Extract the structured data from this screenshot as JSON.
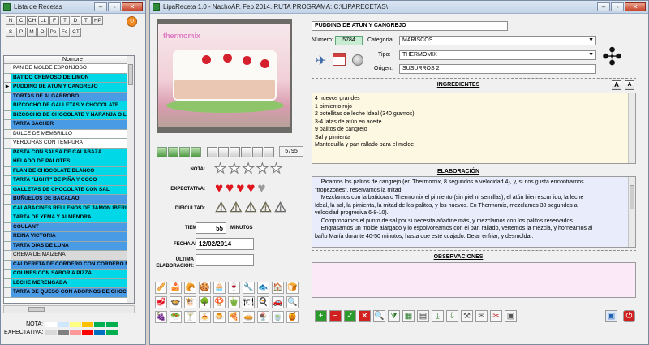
{
  "left_window": {
    "title": "Lista de Recetas",
    "letter_buttons": [
      "N",
      "C",
      "CH",
      "LL",
      "F",
      "T",
      "D",
      "Ti",
      "HP",
      "S",
      "P",
      "M",
      "O",
      "Pe",
      "Fc",
      "CT"
    ],
    "orange_button": "↻",
    "column_header": "Nombre",
    "rows": [
      {
        "name": "PAN DE MOLDE ESPONJOSO",
        "color": "w"
      },
      {
        "name": "BATIDO CREMOSO DE LIMON",
        "color": "c"
      },
      {
        "name": "PUDDING DE ATUN Y CANGREJO",
        "color": "c",
        "current": true
      },
      {
        "name": "TORTAS DE ALGARROBO",
        "color": "b"
      },
      {
        "name": "BIZCOCHO DE GALLETAS Y CHOCOLATE",
        "color": "c"
      },
      {
        "name": "BIZCOCHO DE CHOCOLATE Y NARANJA O LIMON",
        "color": "c"
      },
      {
        "name": "TARTA SACHER",
        "color": "b"
      },
      {
        "name": "DULCE DE MEMBRILLO",
        "color": "w"
      },
      {
        "name": "VERDURAS CON TEMPURA",
        "color": "w"
      },
      {
        "name": "PASTA CON SALSA DE CALABAZA",
        "color": "c"
      },
      {
        "name": "HELADO DE PALOTES",
        "color": "c"
      },
      {
        "name": "FLAN DE CHOCOLATE BLANCO",
        "color": "c"
      },
      {
        "name": "TARTA \"LIGHT\" DE PIÑA Y COCO",
        "color": "c"
      },
      {
        "name": "GALLETAS DE CHOCOLATE CON SAL",
        "color": "c"
      },
      {
        "name": "BUÑUELOS DE BACALAO",
        "color": "b"
      },
      {
        "name": "CALABACINES RELLENOS DE JAMON IBERICO Y",
        "color": "c"
      },
      {
        "name": "TARTA DE YEMA Y ALMENDRA",
        "color": "c"
      },
      {
        "name": "COULANT",
        "color": "b"
      },
      {
        "name": "REINA VICTORIA",
        "color": "b"
      },
      {
        "name": "TARTA DIAS DE LUNA",
        "color": "b"
      },
      {
        "name": "CREMA DE MAIZENA",
        "color": "g"
      },
      {
        "name": "CALDERETA DE CORDERO CON CORDERO MAN",
        "color": "b"
      },
      {
        "name": "COLINES CON SABOR A PIZZA",
        "color": "c"
      },
      {
        "name": "LECHE MERENGADA",
        "color": "c"
      },
      {
        "name": "TARTA DE QUESO CON ADORNOS DE CHOCOLA",
        "color": "b"
      }
    ],
    "legend": {
      "nota_label": "NOTA:",
      "expectativa_label": "EXPECTATIVA:",
      "nota_colors": [
        "#ffffff",
        "#cfe8ff",
        "#ffff80",
        "#ffc000",
        "#00b050",
        "#00b050"
      ],
      "expectativa_colors": [
        "#d9d9d9",
        "#808080",
        "#ff9999",
        "#ff0000",
        "#0070c0",
        "#00b050"
      ]
    }
  },
  "main_window": {
    "title": "LipaReceta 1.0 - NachoAP. Feb 2014. RUTA PROGRAMA: C:\\LIPARECETAS\\",
    "photo_watermark": "thermomix",
    "counter": "5795",
    "nota_label": "NOTA:",
    "nota_stars": 0,
    "expectativa_label": "EXPECTATIVA:",
    "expectativa_hearts": 4,
    "dificultad_label": "DIFICULTAD:",
    "dificultad_level": 4,
    "tiempo_label": "TIEMPO:",
    "tiempo_value": "55",
    "tiempo_unit": "MINUTOS",
    "fecha_alta_label": "FECHA ALTA:",
    "fecha_alta_value": "12/02/2014",
    "ultima_label": "ÚLTIMA ELABORACIÓN:",
    "recipe_title": "PUDDING DE ATUN Y CANGREJO",
    "numero_label": "Número:",
    "numero_value": "5784",
    "categoria_label": "Categoría:",
    "categoria_value": "MARISCOS",
    "tipo_label": "Tipo:",
    "tipo_value": "THERMOMIX",
    "origen_label": "Origen:",
    "origen_value": "SUSURROS 2",
    "ingredientes_title": "INGREDIENTES",
    "ingredientes": [
      "4 huevos grandes",
      "1 pimiento rojo",
      "2 botellitas de leche Ideal (340 gramos)",
      "3-4 latas de atún en aceite",
      "9 palitos de cangrejo",
      "Sal y pimienta",
      "Mantequilla y pan rallado para el molde"
    ],
    "elaboracion_title": "ELABORACIÓN",
    "elaboracion": [
      "    Picamos los palitos de cangrejo (en Thermomix, 8 segundos a velocidad 4), y, si nos gusta encontrarnos",
      "\"tropezones\", reservamos la mitad.",
      "    Mezclamos con la batidora o Thermomix el pimiento (sin piel ni semillas), el atún bien escurrido, la leche",
      "Ideal, la sal, la pimienta, la mitad de los palitos, y los huevos. En Thermomix, mezclamos 30 segundos a",
      "velocidad progresiva 6-8-10).",
      "    Comprobamos el punto de sal por si necesita añadirle más, y mezclamos con los palitos reservados.",
      "    Engrasamos un molde alargado y lo espolvoreamos con el pan rallado, vertemos la mezcla, y horneamos al",
      "baño María durante 40-50 minutos, hasta que esté cuajado. Dejar enfriar, y desmoldar."
    ],
    "observaciones_title": "OBSERVACIONES",
    "observaciones": "",
    "font_buttons": [
      "A",
      "A"
    ]
  },
  "colors": {
    "cyan_row": "#00d8e8",
    "blue_row": "#4a9be6",
    "ingredients_bg": "#fdf8e2",
    "elaboration_bg": "#e8ecfb",
    "observations_bg": "#fbe9f7"
  }
}
